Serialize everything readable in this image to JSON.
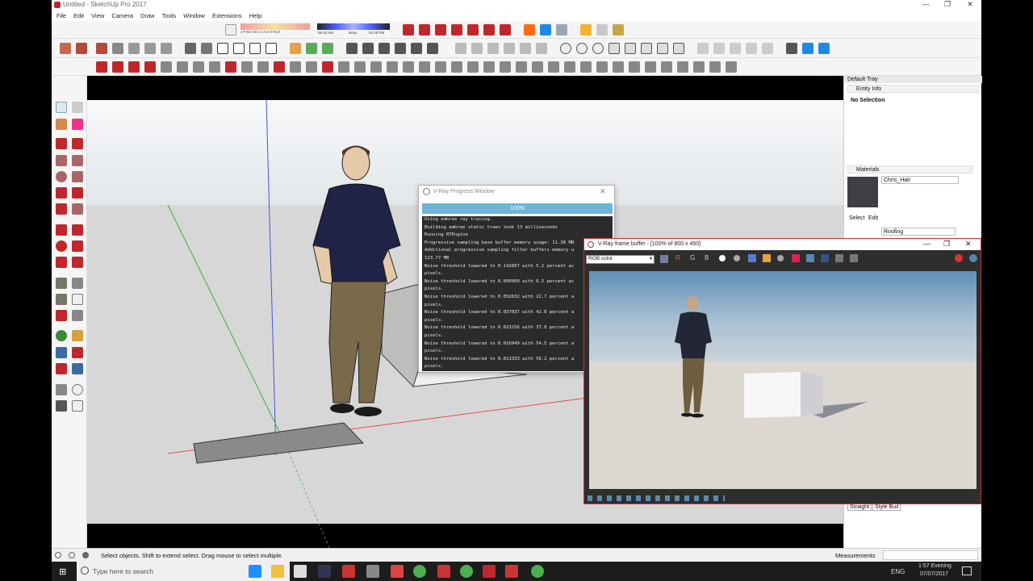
{
  "window": {
    "title": "Untitled - SketchUp Pro 2017",
    "controls": [
      "—",
      "❐",
      "✕"
    ]
  },
  "menu": [
    "File",
    "Edit",
    "View",
    "Camera",
    "Draw",
    "Tools",
    "Window",
    "Extensions",
    "Help"
  ],
  "shadow_bar": {
    "months": "J F M A M J J A S O N D",
    "time_start": "06:43 AM",
    "time_mid": "Noon",
    "time_end": "04:45 PM"
  },
  "tray": {
    "title": "Default Tray",
    "entity_info": {
      "header": "Entity Info",
      "selection": "No Selection"
    },
    "materials": {
      "header": "Materials",
      "name": "Chris_Hair",
      "tab_select": "Select",
      "tab_edit": "Edit",
      "library": "Roofing"
    },
    "styles_buttons": [
      "Straight",
      "Style Buil"
    ]
  },
  "vray_progress": {
    "title": "V-Ray Progress Window",
    "percent": "100%",
    "log": [
      "Using embree ray tracing.",
      "Building embree static trees took 13 milliseconds",
      "Running RTEngine",
      "Progressive sampling base buffer memory usage: 11.38 MB",
      "Additional progressive sampling filter buffers memory u",
      "123.77 MB",
      "Noise threshold lowered to 0.142857 with 5.2 percent ac",
      "pixels.",
      "Noise threshold lowered to 0.090909 with 6.5 percent ac",
      "pixels.",
      "Noise threshold lowered to 0.052632 with 22.7 percent a",
      "pixels.",
      "Noise threshold lowered to 0.037037 with 42.8 percent a",
      "pixels.",
      "Noise threshold lowered to 0.023256 with 37.8 percent a",
      "pixels.",
      "Noise threshold lowered to 0.016949 with 54.5 percent a",
      "pixels.",
      "Noise threshold lowered to 0.013333 with 56.2 percent a",
      "pixels."
    ]
  },
  "vray_frame_buffer": {
    "title": "V-Ray frame buffer - [100% of 800 x 450]",
    "channel": "RGB color",
    "channel_buttons": [
      "R",
      "G",
      "B"
    ]
  },
  "statusbar": {
    "hint": "Select objects. Shift to extend select. Drag mouse to select multiple.",
    "measurements_label": "Measurements"
  },
  "taskbar": {
    "search_placeholder": "Type here to search",
    "lang": "ENG",
    "time": "1:57 Evening",
    "date": "07/07/2017"
  },
  "colors": {
    "accent_blue": "#6eb5d8",
    "sketchup_red": "#c0272d",
    "taskbar": "#1c1c1c"
  }
}
